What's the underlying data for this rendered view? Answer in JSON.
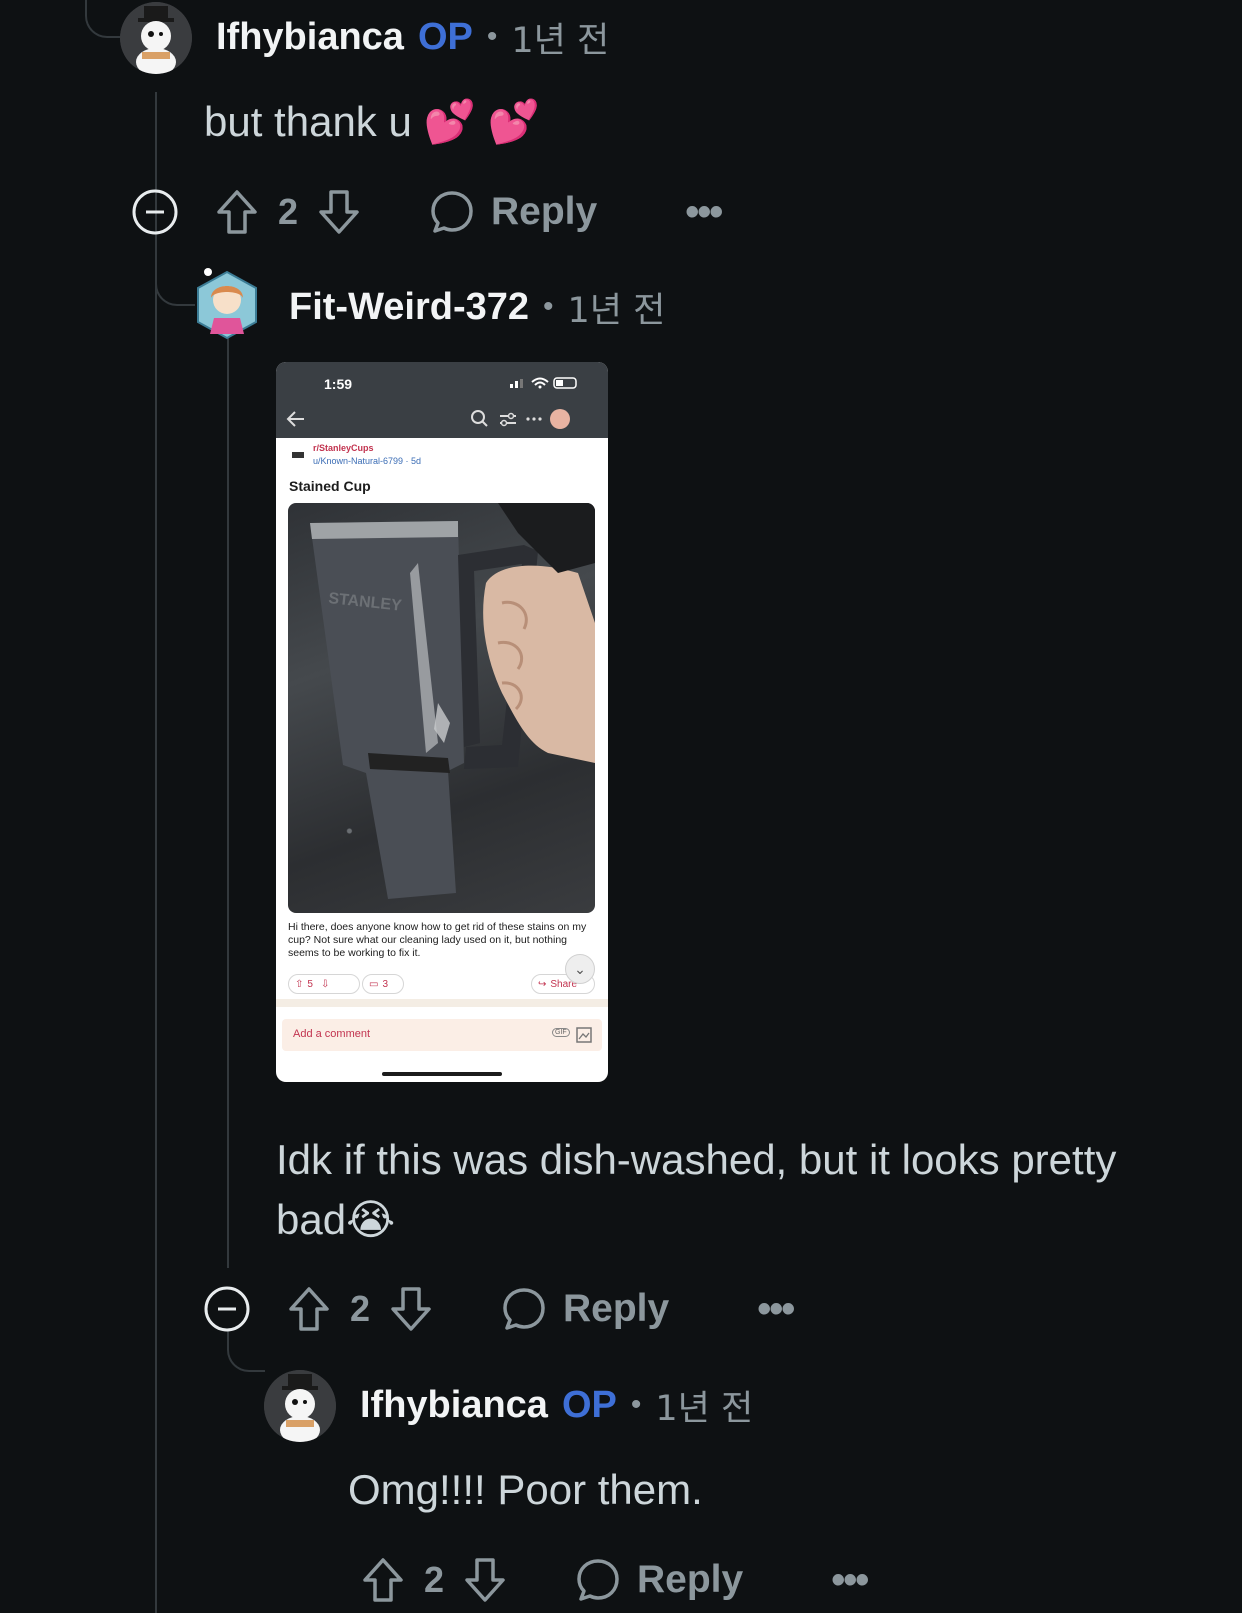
{
  "comments": [
    {
      "username": "Ifhybianca",
      "op_badge": "OP",
      "separator": "•",
      "age": "1년 전",
      "body": "but thank u 💕 💕",
      "votes": "2",
      "reply_label": "Reply",
      "more_label": "•••"
    },
    {
      "username": "Fit-Weird-372",
      "separator": "•",
      "age": "1년 전",
      "body": "Idk if this was dish-washed, but it looks pretty bad😭",
      "votes": "2",
      "reply_label": "Reply",
      "more_label": "•••",
      "attachment": {
        "status_time": "1:59",
        "subreddit": "r/StanleyCups",
        "author_meta": "u/Known-Natural-6799 · 5d",
        "post_title": "Stained Cup",
        "cup_brand": "STANLEY",
        "post_body": "Hi there, does anyone know how to get rid of these stains on my cup? Not sure what our cleaning lady used on it, but nothing seems to be working to fix it.",
        "post_votes": "5",
        "post_comments": "3",
        "share_label": "Share",
        "comment_placeholder": "Add a comment",
        "gif_label": "GIF"
      }
    },
    {
      "username": "Ifhybianca",
      "op_badge": "OP",
      "separator": "•",
      "age": "1년 전",
      "body": "Omg!!!! Poor them.",
      "votes": "2",
      "reply_label": "Reply",
      "more_label": "•••"
    }
  ],
  "colors": {
    "background": "#0e1113",
    "username": "#f2f4f5",
    "op_badge": "#3e6fd6",
    "muted": "#8c979d",
    "thread_line": "#33393d"
  },
  "icons": [
    "collapse-icon",
    "upvote-icon",
    "downvote-icon",
    "comment-bubble-icon",
    "more-icon"
  ]
}
